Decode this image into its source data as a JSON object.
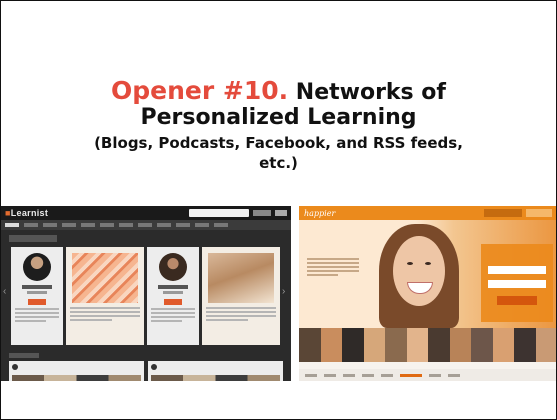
{
  "slide": {
    "title_opener": "Opener #10.",
    "title_rest": "Networks of",
    "title_line2": "Personalized Learning",
    "subtitle_line1": "(Blogs, Podcasts, Facebook, and RSS feeds,",
    "subtitle_line2": "etc.)",
    "opener_color": "#e44b3c"
  },
  "learnist": {
    "logo": "Learnist",
    "author1": "Pardeep Miller",
    "author2": "Lauren Aldine Budde",
    "board_caption": "The Ultimate PBL!",
    "follow_label": "Follow",
    "category1": "Business",
    "category2": "Food & Drinks",
    "accent_color": "#e05a2b"
  },
  "happier": {
    "logo": "happier",
    "question": "What makes you happy?",
    "join_title": "Join Happier",
    "join_button": "Join Happier",
    "share_text": "Share",
    "accent_color": "#eb8a1c"
  }
}
